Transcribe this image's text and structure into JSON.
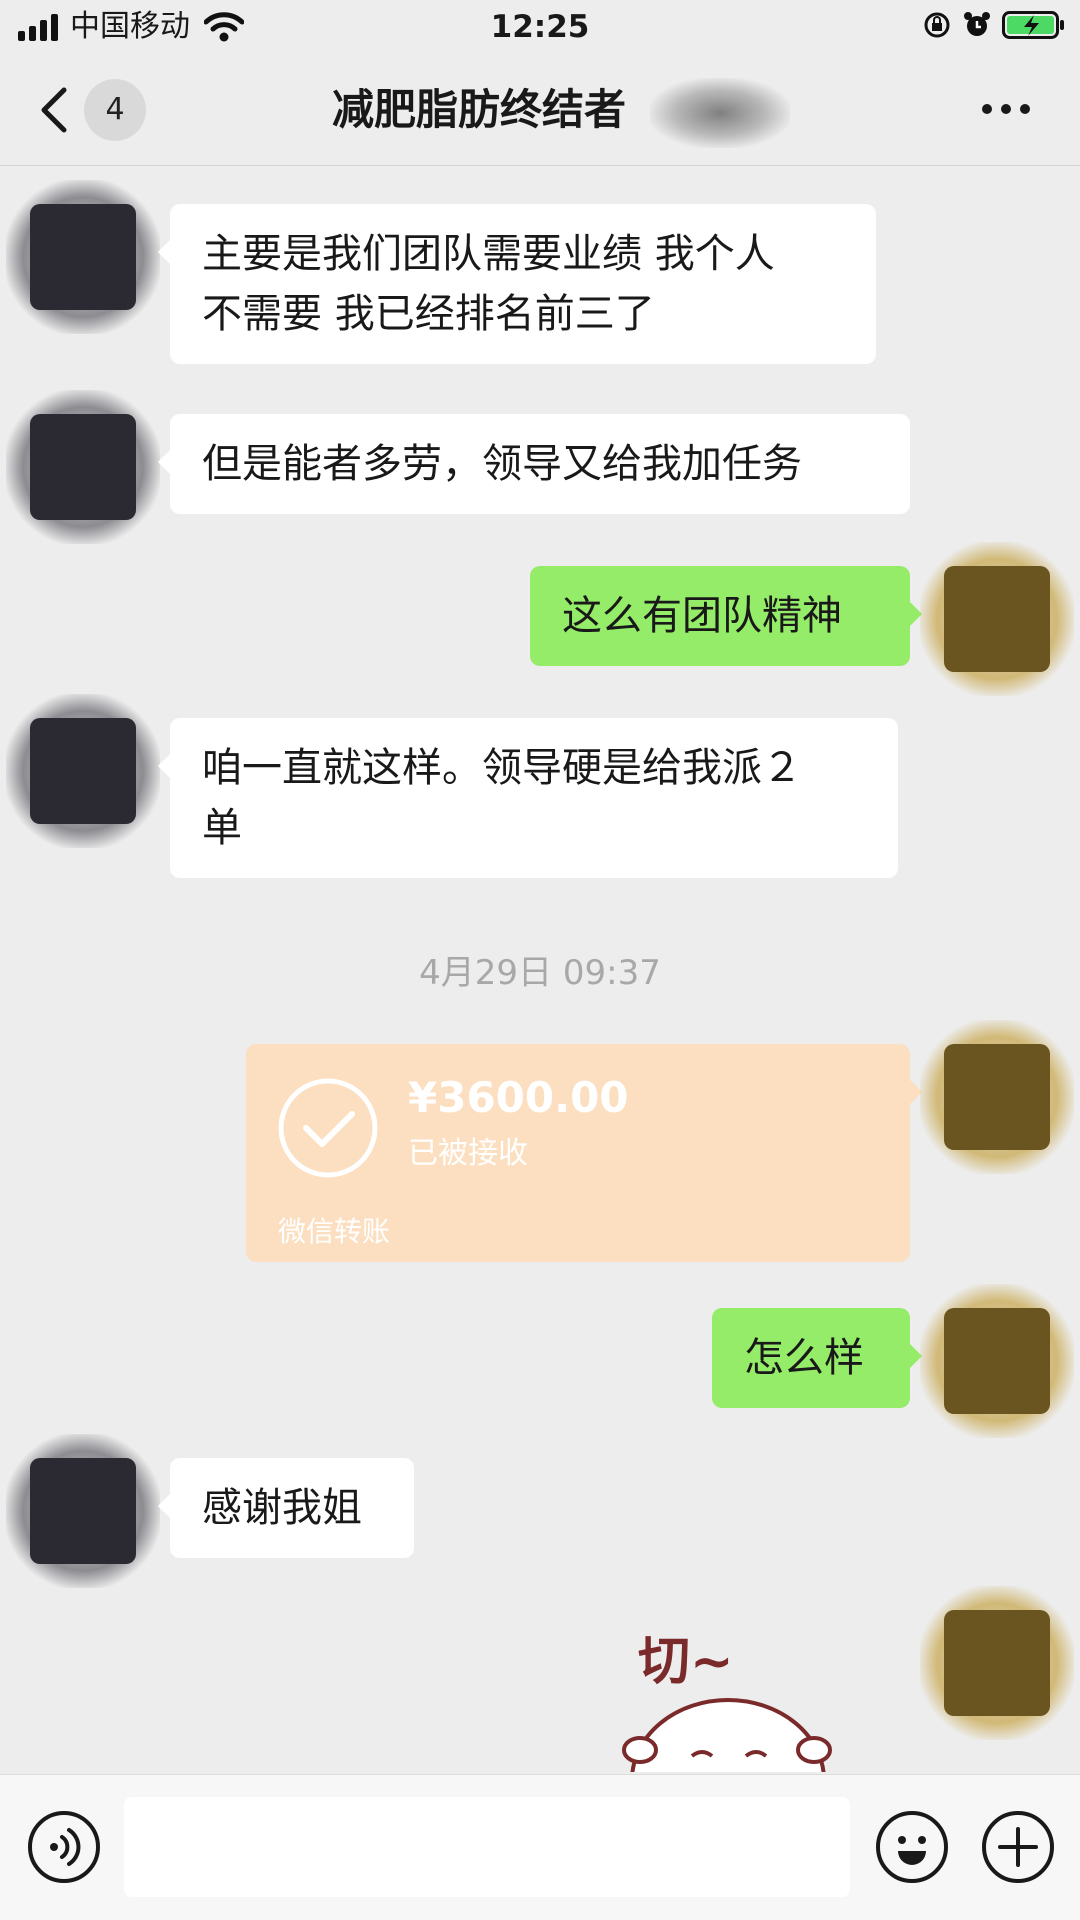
{
  "status_bar": {
    "carrier": "中国移动",
    "time": "12:25",
    "battery_color": "#4cd964"
  },
  "nav": {
    "unread_count": "4",
    "title": "减肥脂肪终结者"
  },
  "messages": [
    {
      "sender": "other",
      "text": "主要是我们团队需要业绩 我个人\n不需要 我已经排名前三了"
    },
    {
      "sender": "other",
      "text": "但是能者多劳，领导又给我加任务"
    },
    {
      "sender": "self",
      "text": "这么有团队精神"
    },
    {
      "sender": "other",
      "text": "咱一直就这样。领导硬是给我派２\n单"
    },
    {
      "sender": "self",
      "text": "怎么样"
    },
    {
      "sender": "other",
      "text": "感谢我姐"
    }
  ],
  "timestamp": "4月29日 09:37",
  "transfer": {
    "amount": "¥3600.00",
    "status": "已被接收",
    "label": "微信转账"
  },
  "sticker": {
    "text": "切~"
  },
  "colors": {
    "background": "#ededed",
    "outgoing_bubble": "#95ec69",
    "incoming_bubble": "#ffffff",
    "transfer_card": "#fcdfc0"
  },
  "icons": [
    "signal-icon",
    "wifi-icon",
    "lock-rotation-icon",
    "alarm-icon",
    "battery-icon",
    "back-chevron-icon",
    "more-icon",
    "check-circle-icon",
    "voice-icon",
    "emoji-icon",
    "plus-icon"
  ]
}
